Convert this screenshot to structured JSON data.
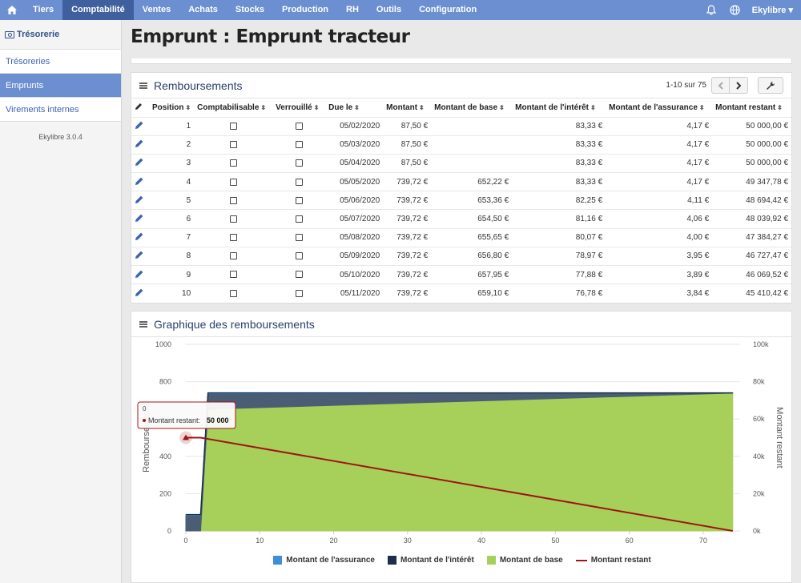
{
  "nav": {
    "items": [
      "Tiers",
      "Comptabilité",
      "Ventes",
      "Achats",
      "Stocks",
      "Production",
      "RH",
      "Outils",
      "Configuration"
    ],
    "active": "Comptabilité",
    "user": "Ekylibre ▾"
  },
  "sidebar": {
    "title": "Trésorerie",
    "items": [
      "Trésoreries",
      "Emprunts",
      "Virements internes"
    ],
    "active": "Emprunts",
    "version": "Ekylibre 3.0.4"
  },
  "page": {
    "title": "Emprunt : Emprunt tracteur"
  },
  "table_panel": {
    "title": "Remboursements",
    "pager_info": "1-10 sur 75",
    "columns": [
      "Position",
      "Comptabilisable",
      "Verrouillé",
      "Due le",
      "Montant",
      "Montant de base",
      "Montant de l'intérêt",
      "Montant de l'assurance",
      "Montant restant"
    ],
    "rows": [
      [
        "1",
        "05/02/2020",
        "87,50 €",
        "",
        "83,33 €",
        "4,17 €",
        "50 000,00 €"
      ],
      [
        "2",
        "05/03/2020",
        "87,50 €",
        "",
        "83,33 €",
        "4,17 €",
        "50 000,00 €"
      ],
      [
        "3",
        "05/04/2020",
        "87,50 €",
        "",
        "83,33 €",
        "4,17 €",
        "50 000,00 €"
      ],
      [
        "4",
        "05/05/2020",
        "739,72 €",
        "652,22 €",
        "83,33 €",
        "4,17 €",
        "49 347,78 €"
      ],
      [
        "5",
        "05/06/2020",
        "739,72 €",
        "653,36 €",
        "82,25 €",
        "4,11 €",
        "48 694,42 €"
      ],
      [
        "6",
        "05/07/2020",
        "739,72 €",
        "654,50 €",
        "81,16 €",
        "4,06 €",
        "48 039,92 €"
      ],
      [
        "7",
        "05/08/2020",
        "739,72 €",
        "655,65 €",
        "80,07 €",
        "4,00 €",
        "47 384,27 €"
      ],
      [
        "8",
        "05/09/2020",
        "739,72 €",
        "656,80 €",
        "78,97 €",
        "3,95 €",
        "46 727,47 €"
      ],
      [
        "9",
        "05/10/2020",
        "739,72 €",
        "657,95 €",
        "77,88 €",
        "3,89 €",
        "46 069,52 €"
      ],
      [
        "10",
        "05/11/2020",
        "739,72 €",
        "659,10 €",
        "76,78 €",
        "3,84 €",
        "45 410,42 €"
      ]
    ]
  },
  "chart_panel": {
    "title": "Graphique des remboursements"
  },
  "tooltip": {
    "header": "0",
    "label": "Montant restant: ",
    "value": "50 000"
  },
  "colors": {
    "nav": "#6b8fd0",
    "assurance": "#3f8fd8",
    "interet": "#1b2f46",
    "base": "#a6d05a",
    "restant": "#a01414"
  },
  "chart_data": {
    "type": "area",
    "title": "",
    "xlabel": "",
    "ylabel": "Remboursements",
    "y2label": "Montant restant",
    "xlim": [
      0,
      75
    ],
    "ylim": [
      0,
      1000
    ],
    "y2lim": [
      0,
      100000
    ],
    "x_ticks": [
      0,
      10,
      20,
      30,
      40,
      50,
      60,
      70
    ],
    "y_ticks": [
      0,
      200,
      400,
      600,
      800,
      1000
    ],
    "y2_ticks": [
      "0k",
      "20k",
      "40k",
      "60k",
      "80k",
      "100k"
    ],
    "grid": true,
    "legend_position": "bottom",
    "series": [
      {
        "name": "Montant de l'assurance",
        "kind": "stacked-area",
        "x": [
          0,
          2,
          3,
          74
        ],
        "values": [
          4.17,
          4.17,
          4.17,
          0.05
        ]
      },
      {
        "name": "Montant de l'intérêt",
        "kind": "stacked-area",
        "x": [
          0,
          2,
          3,
          74
        ],
        "values": [
          83.33,
          83.33,
          83.33,
          1
        ]
      },
      {
        "name": "Montant de base",
        "kind": "stacked-area",
        "x": [
          0,
          2,
          3,
          74
        ],
        "values": [
          0,
          0,
          652.22,
          738.7
        ]
      },
      {
        "name": "Montant restant",
        "kind": "line",
        "axis": "right",
        "x": [
          0,
          2,
          74
        ],
        "values": [
          50000,
          50000,
          0
        ]
      }
    ]
  }
}
